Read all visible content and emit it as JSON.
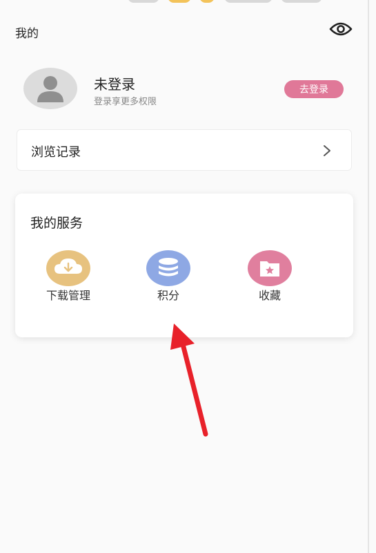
{
  "header": {
    "title": "我的",
    "eye_icon": "eye-icon"
  },
  "profile": {
    "name": "未登录",
    "subtitle": "登录享更多权限",
    "login_button": "去登录",
    "avatar_icon": "user-silhouette-icon"
  },
  "history": {
    "label": "浏览记录",
    "chevron_icon": "chevron-right-icon"
  },
  "services": {
    "title": "我的服务",
    "items": [
      {
        "label": "下载管理",
        "icon": "download-cloud-icon",
        "color": "#e7c27f"
      },
      {
        "label": "积分",
        "icon": "coin-stack-icon",
        "color": "#8ea8e4"
      },
      {
        "label": "收藏",
        "icon": "folder-star-icon",
        "color": "#e07f9e"
      }
    ]
  },
  "colors": {
    "accent": "#e07898",
    "annotation_arrow": "#e8212a"
  }
}
